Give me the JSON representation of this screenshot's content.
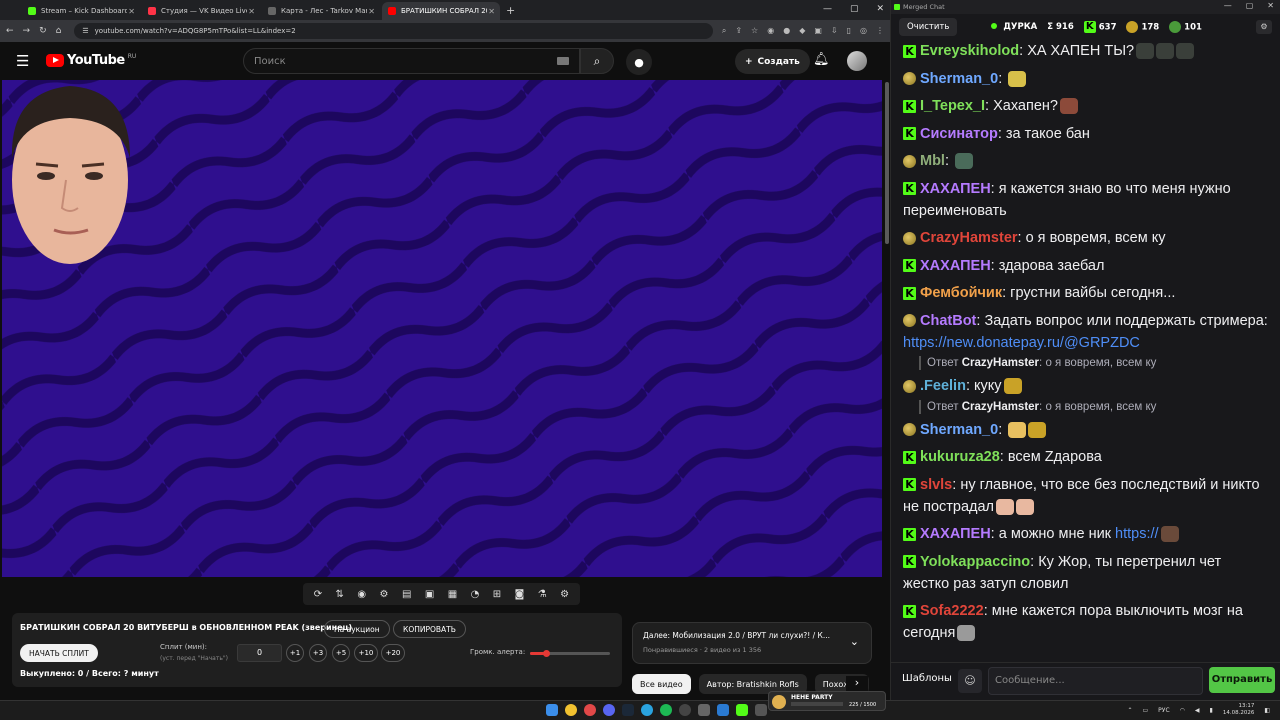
{
  "browser": {
    "tabs": [
      {
        "title": "Stream – Kick Dashboard",
        "color": "#53fc18",
        "active": false
      },
      {
        "title": "Студия — VK Видео Live",
        "color": "#ff3347",
        "active": false
      },
      {
        "title": "Карта - Лес - Tarkov Market",
        "color": "#666666",
        "active": false
      },
      {
        "title": "БРАТИШКИН СОБРАЛ 20 ВИТ",
        "color": "#ff0000",
        "active": true
      }
    ],
    "url": "youtube.com/watch?v=ADQG8P5mTPo&list=LL&index=2"
  },
  "youtube": {
    "logo_text": "YouTube",
    "region": "RU",
    "search_placeholder": "Поиск",
    "create_label": "Создать"
  },
  "panel": {
    "title": "БРАТИШКИН СОБРАЛ 20 ВИТУБЕРШ в ОБНОВЛЕННОМ PEAK (зверинец)",
    "auction_label": "На аукцион",
    "copy_label": "КОПИРОВАТЬ",
    "split_button": "НАЧАТЬ СПЛИТ",
    "split_label": "Сплит (мин):",
    "split_hint": "(уст. перед \"Начать\")",
    "split_value": "0",
    "increments": [
      "+1",
      "+3",
      "+5",
      "+10",
      "+20"
    ],
    "alert_volume_label": "Громк. алерта:",
    "alert_volume": 0.2,
    "bought_text": "Выкуплено: 0 / Всего: ? минут"
  },
  "next_card": {
    "title": "Далее: Мобилизация 2.0 / ВРУТ ли слухи?! / К...",
    "subtitle": "Понравившиеся · 2 видео из 1 356"
  },
  "chips": [
    "Все видео",
    "Автор: Bratishkin Rofls",
    "Похожие"
  ],
  "chat": {
    "window_title": "Merged Chat",
    "clear_label": "Очистить",
    "status_label": "ДУРКА",
    "sum_label": "Σ 916",
    "kick_count": "637",
    "other_count": "178",
    "viewers_count": "101",
    "messages": [
      {
        "badge": "kick",
        "user": "Evreyskiholod",
        "color": "#7fe05a",
        "text": "ХА ХАПЕН ТЫ?",
        "emotes": [
          "#3a3f3a",
          "#3a3f3a",
          "#3a3f3a"
        ]
      },
      {
        "badge": "vk",
        "user": "Sherman_0",
        "color": "#6fa8ff",
        "text": "",
        "emotes": [
          "#d8c04a"
        ]
      },
      {
        "badge": "kick",
        "user": "I_Tepex_I",
        "color": "#7fe05a",
        "text": "Хахапен?",
        "emotes": [
          "#8c4a3a"
        ]
      },
      {
        "badge": "kick",
        "user": "Сисинатор",
        "color": "#b57bff",
        "text": "за такое бан",
        "emotes": []
      },
      {
        "badge": "vk",
        "user": "Mbl",
        "color": "#8fae7a",
        "text": "",
        "emotes": [
          "#4a6b5a"
        ]
      },
      {
        "badge": "kick",
        "user": "ХАХАПЕН",
        "color": "#b57bff",
        "text": "я кажется знаю во что меня нужно переименовать",
        "emotes": []
      },
      {
        "badge": "vk",
        "user": "CrazyHamster",
        "color": "#e0453a",
        "text": "о я вовремя, всем ку",
        "emotes": []
      },
      {
        "badge": "kick",
        "user": "ХАХАПЕН",
        "color": "#b57bff",
        "text": "здарова заебал",
        "emotes": []
      },
      {
        "badge": "kick",
        "user": "Фембойчик",
        "color": "#f0a04a",
        "text": "грустни вайбы сегодня...",
        "emotes": []
      },
      {
        "badge": "vk",
        "user": "ChatBot",
        "color": "#b57bff",
        "text": "Задать вопрос или поддержать стримера: ",
        "link": "https://new.donatepay.ru/@GRPZDC",
        "emotes": []
      },
      {
        "reply_to": "CrazyHamster",
        "reply_text": "о я вовремя, всем ку",
        "badge": "vk",
        "user": ".Feelin",
        "color": "#5fb0d8",
        "text": "куку",
        "emotes": [
          "#c9a227"
        ]
      },
      {
        "reply_to": "CrazyHamster",
        "reply_text": "о я вовремя, всем ку",
        "badge": "vk",
        "user": "Sherman_0",
        "color": "#6fa8ff",
        "text": "",
        "emotes": [
          "#e8c060",
          "#c9a227"
        ]
      },
      {
        "badge": "kick",
        "user": "kukuruza28",
        "color": "#7fe05a",
        "text": "всем Zдарова",
        "emotes": []
      },
      {
        "badge": "kick",
        "user": "slvls",
        "color": "#e0453a",
        "text": "ну главное, что все без последствий и никто не пострадал",
        "emotes": [
          "#e8b8a0",
          "#e8b8a0"
        ]
      },
      {
        "badge": "kick",
        "user": "ХАХАПЕН",
        "color": "#b57bff",
        "text": "а можно мне ник ",
        "link": "https://",
        "emotes": [
          "#6a4a3a"
        ]
      },
      {
        "badge": "kick",
        "user": "Yolokappaccino",
        "color": "#7fe05a",
        "text": "Ку Жор, ты перетренил чет жестко раз затуп словил",
        "emotes": []
      },
      {
        "badge": "kick",
        "user": "Sofa2222",
        "color": "#e0453a",
        "text": "мне кажется пора выключить мозг на сегодня",
        "emotes": [
          "#9a9a9a"
        ]
      }
    ],
    "reply_prefix": "Ответ",
    "templates_label": "Шаблоны",
    "input_placeholder": "Сообщение...",
    "send_label": "Отправить"
  },
  "taskbar": {
    "widget_title": "HEHE PARTY",
    "widget_value": "225 / 1500",
    "lang": "РУС",
    "time": "13:17",
    "date": "14.08.2026"
  }
}
